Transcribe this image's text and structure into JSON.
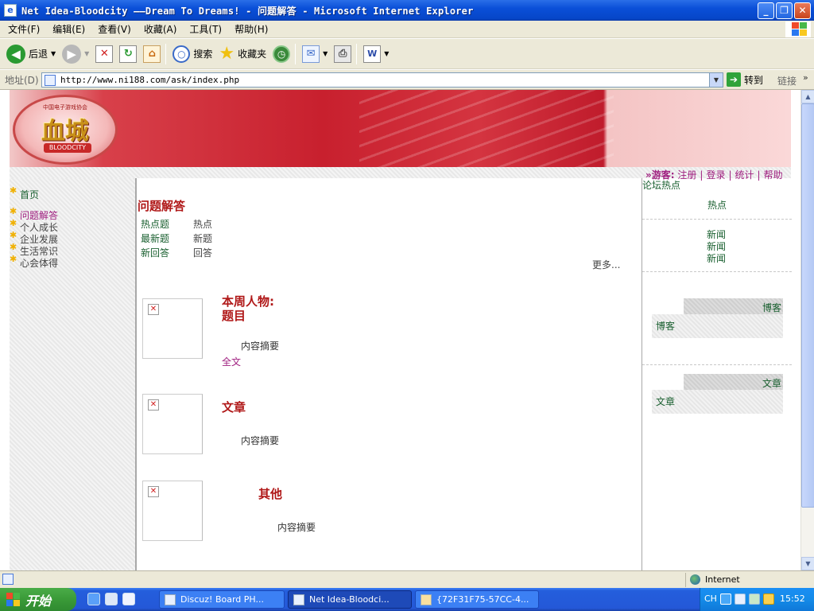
{
  "window": {
    "title": "Net Idea-Bloodcity ——Dream To Dreams! - 问题解答 - Microsoft Internet Explorer",
    "minimize": "_",
    "maximize": "❐",
    "close": "✕"
  },
  "menubar": {
    "items": [
      "文件(F)",
      "编辑(E)",
      "查看(V)",
      "收藏(A)",
      "工具(T)",
      "帮助(H)"
    ]
  },
  "toolbar": {
    "back_label": "后退",
    "search_label": "搜索",
    "favorites_label": "收藏夹"
  },
  "addressbar": {
    "label": "地址(D)",
    "url": "http://www.ni188.com/ask/index.php",
    "go_label": "转到",
    "links_label": "链接"
  },
  "page": {
    "banner": {
      "logo_top": "中国电子游戏协会",
      "logo_main": "血城",
      "logo_sub": "BLOODCITY"
    },
    "userlinks": {
      "lead": "»游客:",
      "items": [
        "注册",
        "登录",
        "统计",
        "帮助"
      ]
    },
    "leftnav": {
      "home": "首页",
      "items": [
        "问题解答",
        "个人成长",
        "企业发展",
        "生活常识",
        "心会体得"
      ]
    },
    "main": {
      "section_title": "问题解答",
      "questions": [
        {
          "key": "热点题",
          "value": "热点"
        },
        {
          "key": "最新题",
          "value": "新题"
        },
        {
          "key": "新回答",
          "value": "回答"
        }
      ],
      "more": "更多...",
      "weekly": {
        "title_line1": "本周人物:",
        "title_line2": "题目",
        "summary": "内容摘要",
        "fulltext": "全文"
      },
      "article": {
        "title": "文章",
        "summary": "内容摘要"
      },
      "other": {
        "title": "其他",
        "summary": "内容摘要"
      }
    },
    "rightbar": {
      "title": "论坛热点",
      "hot": "热点",
      "news": [
        "新闻",
        "新闻",
        "新闻"
      ],
      "blog_head": "博客",
      "blog_item": "博客",
      "article_head": "文章",
      "article_item": "文章"
    }
  },
  "statusbar": {
    "zone": "Internet"
  },
  "taskbar": {
    "start_label": "开始",
    "tasks": [
      {
        "label": "Discuz! Board PH..."
      },
      {
        "label": "Net Idea-Bloodci..."
      },
      {
        "label": "{72F31F75-57CC-4..."
      }
    ],
    "lang": "CH",
    "clock": "15:52"
  },
  "colors": {
    "accent_red": "#b01818",
    "link_green": "#1a6030",
    "link_purple": "#a02080"
  }
}
